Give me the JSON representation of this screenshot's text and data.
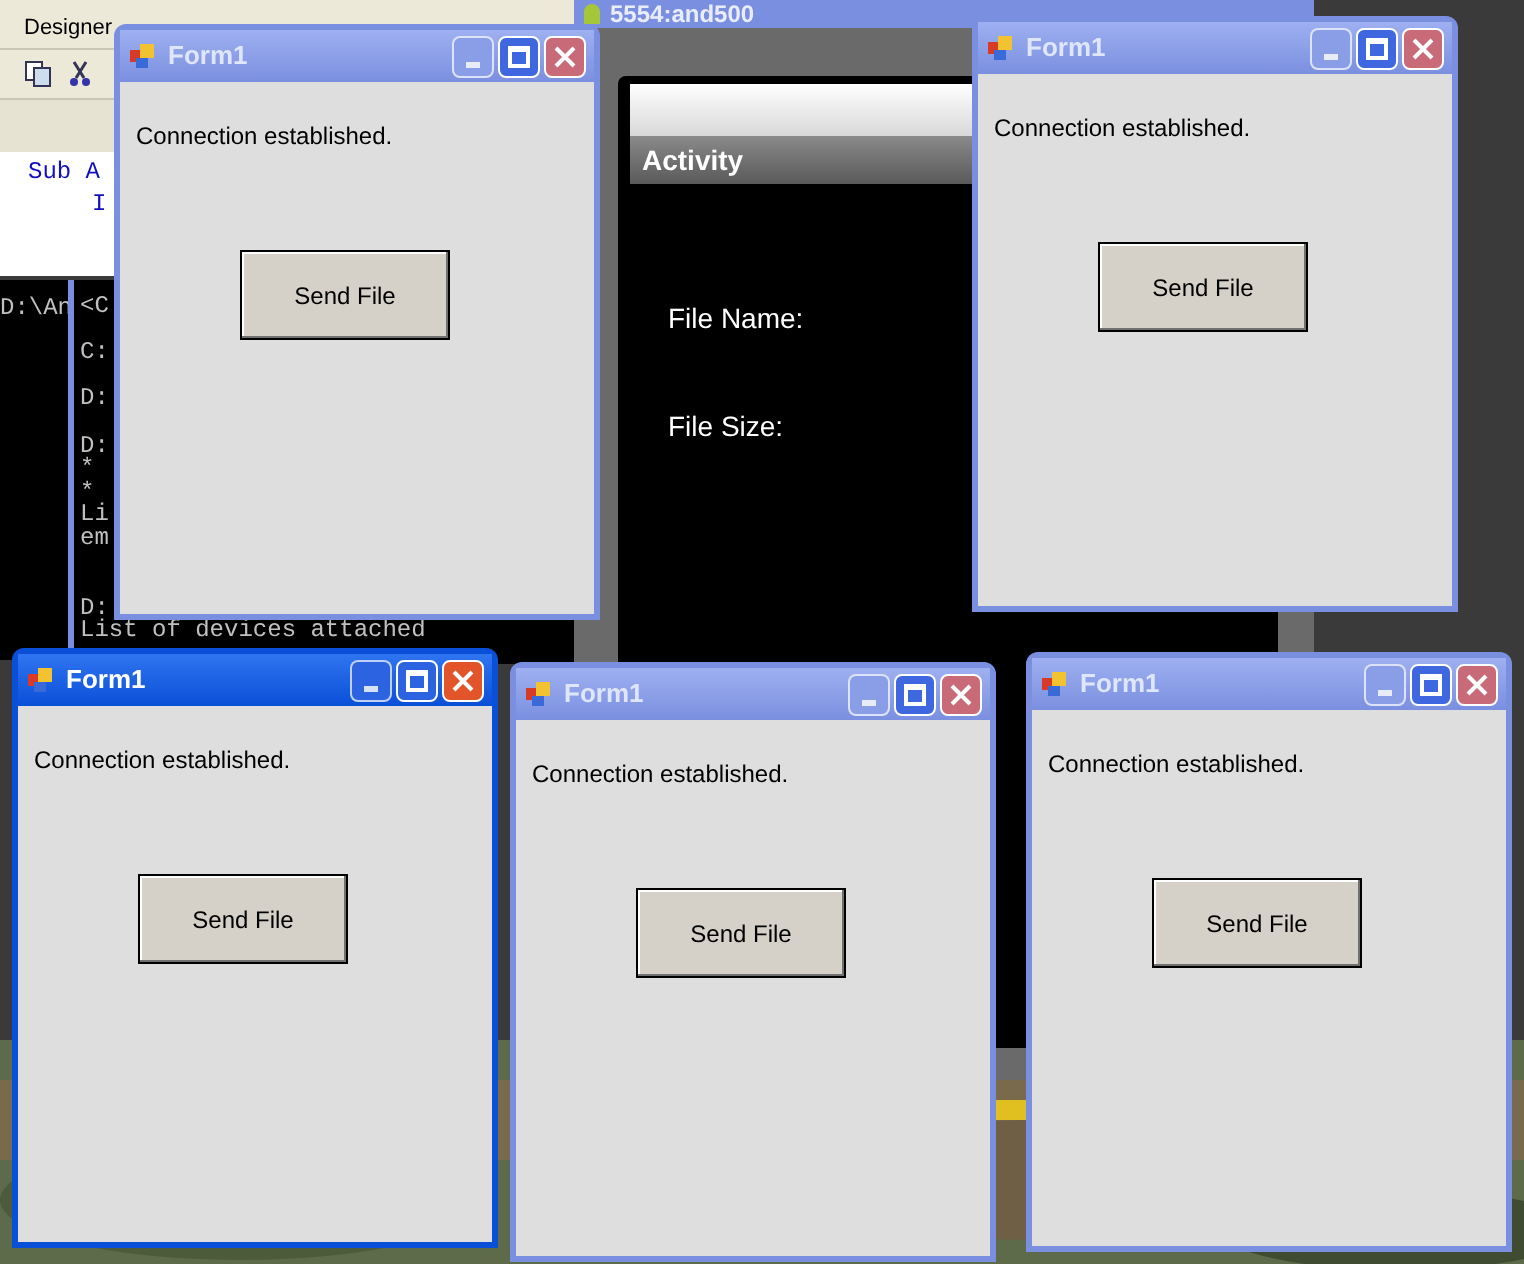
{
  "ide": {
    "menu": [
      "Designer"
    ],
    "code_lines": [
      {
        "text": "Sub A",
        "kind": "keyword"
      },
      {
        "text": "I",
        "kind": "keyword"
      }
    ]
  },
  "console_back": {
    "lines": [
      "D:\\An"
    ]
  },
  "console": {
    "blocks": [
      [
        "<C"
      ],
      [
        "C:"
      ],
      [
        "D:"
      ],
      [
        "D:",
        "*",
        "*",
        "Li",
        "em"
      ],
      [
        "D:",
        "List of devices attached"
      ]
    ]
  },
  "emulator": {
    "title": "5554:and500",
    "action_bar": "Activity",
    "fields": [
      "File Name:",
      "File Size:"
    ]
  },
  "windows": [
    {
      "title": "Form1",
      "active": false,
      "message": "Connection established.",
      "button": "Send File"
    },
    {
      "title": "Form1",
      "active": false,
      "message": "Connection established.",
      "button": "Send File"
    },
    {
      "title": "Form1",
      "active": true,
      "message": "Connection established.",
      "button": "Send File"
    },
    {
      "title": "Form1",
      "active": false,
      "message": "Connection established.",
      "button": "Send File"
    },
    {
      "title": "Form1",
      "active": false,
      "message": "Connection established.",
      "button": "Send File"
    }
  ]
}
